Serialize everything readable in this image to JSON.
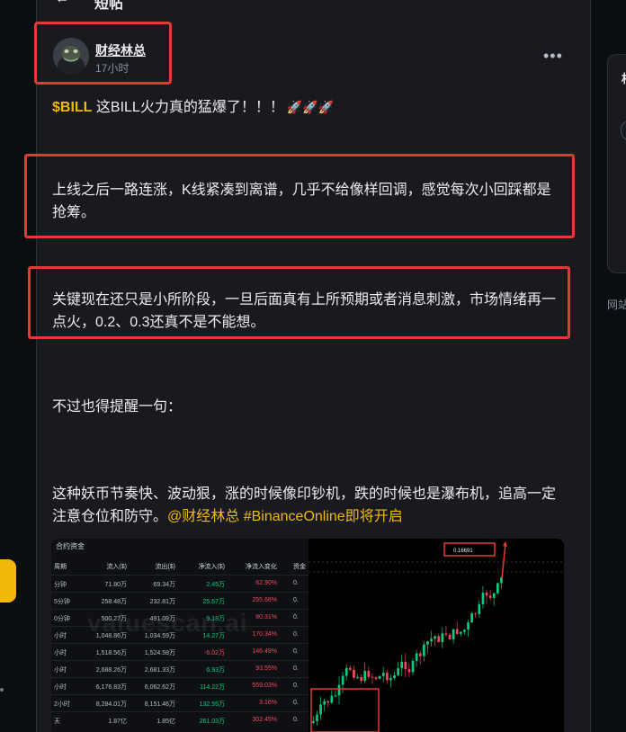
{
  "header": {
    "back_icon": "arrow-left-icon",
    "title": "短帖"
  },
  "post": {
    "author": {
      "name": "财经林总",
      "time": "17小时"
    },
    "more_icon": "more-horizontal-icon",
    "line1": {
      "ticker": "$BILL",
      "text": " 这BILL火力真的猛爆了！！！",
      "rockets": "🚀🚀🚀"
    },
    "para2": "上线之后一路连涨，K线紧凑到离谱，几乎不给像样回调，感觉每次小回踩都是抢筹。",
    "para3": "关键现在还只是小所阶段，一旦后面真有上所预期或者消息刺激，市场情绪再一点火，0.2、0.3还真不是不能想。",
    "para4": "不过也得提醒一句：",
    "para5": {
      "text": "这种妖币节奏快、波动狠，涨的时候像印钞机，跌的时候也是瀑布机，追高一定注意仓位和防守。",
      "mention": "@财经林总",
      "hashtag": "#BinanceOnline即将开启"
    }
  },
  "image": {
    "title": "合约资金",
    "watermark": "valuescan.ai",
    "headers": [
      "周期",
      "流入($)",
      "流出($)",
      "净流入($)",
      "净流入变化",
      "资金"
    ],
    "rows": [
      [
        "分钟",
        "71.80万",
        "69.34万",
        "2.45万",
        "62.90%",
        "0."
      ],
      [
        "5分钟",
        "258.48万",
        "232.81万",
        "25.67万",
        "255.66%",
        "0."
      ],
      [
        "0分钟",
        "500.27万",
        "491.09万",
        "9.18万",
        "80.31%",
        "0."
      ],
      [
        "小时",
        "1,048.86万",
        "1,034.59万",
        "14.27万",
        "170.34%",
        "0."
      ],
      [
        "小时",
        "1,518.56万",
        "1,524.58万",
        "-6.02万",
        "146.49%",
        "0."
      ],
      [
        "小时",
        "2,688.26万",
        "2,681.33万",
        "6.93万",
        "93.55%",
        "0."
      ],
      [
        "小时",
        "6,176.83万",
        "6,062.62万",
        "114.22万",
        "559.03%",
        "0."
      ],
      [
        "2小时",
        "8,284.01万",
        "8,151.46万",
        "132.55万",
        "3.16%",
        "0."
      ],
      [
        "天",
        "1.87亿",
        "1.85亿",
        "261.03万",
        "302.45%",
        "0."
      ]
    ],
    "row_colors": [
      [
        "pos",
        "neg"
      ],
      [
        "pos",
        "neg"
      ],
      [
        "pos",
        "neg"
      ],
      [
        "pos",
        "neg"
      ],
      [
        "neg",
        "neg"
      ],
      [
        "pos",
        "neg"
      ],
      [
        "pos",
        "neg"
      ],
      [
        "pos",
        "neg"
      ],
      [
        "pos",
        "neg"
      ]
    ],
    "chart_price_label": "0.16691"
  },
  "sidebar": {
    "link_text": "网站"
  }
}
